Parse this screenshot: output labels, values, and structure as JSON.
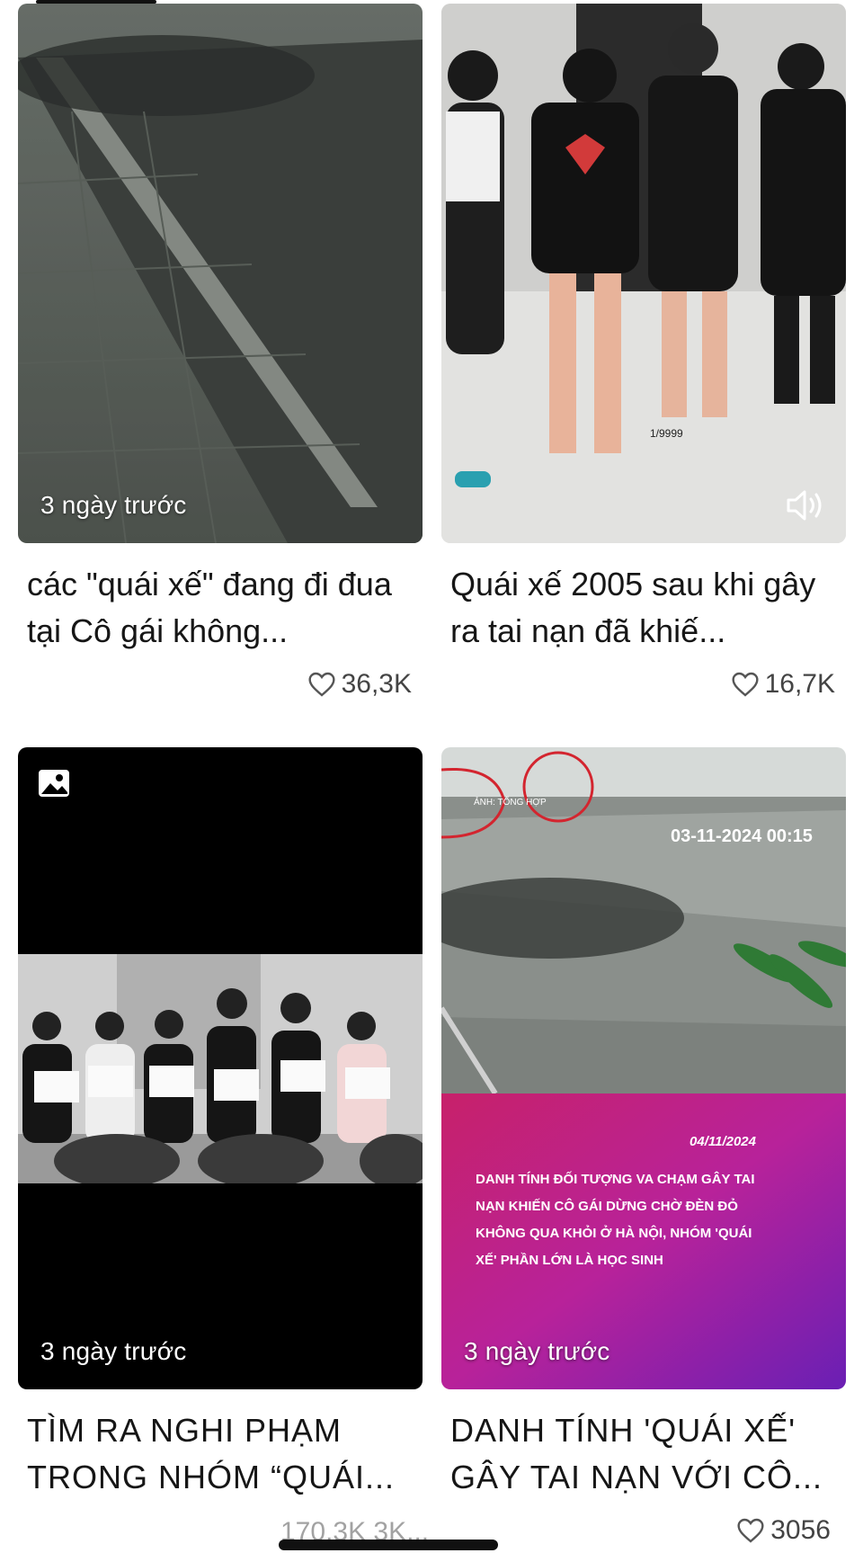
{
  "cards": [
    {
      "time": "3 ngày trước",
      "title": "các \"quái xế\" đang đi đua tại Cô gái không...",
      "likes": "36,3K"
    },
    {
      "title": "Quái xế 2005 sau khi gây ra tai nạn đã khiế...",
      "likes": "16,7K",
      "watermark": "1/9999"
    },
    {
      "time": "3 ngày trước",
      "title": "TÌM RA NGHI PHẠM TRONG NHÓM “QUÁI...",
      "likes_partial": "170,3K 3K..."
    },
    {
      "time": "3 ngày trước",
      "title": "DANH TÍNH 'QUÁI XẾ' GÂY TAI NẠN VỚI CÔ...",
      "likes": "3056",
      "overlay_source": "ẢNH: TỔNG HỢP",
      "overlay_timestamp": "03-11-2024 00:15",
      "overlay_date": "04/11/2024",
      "overlay_text": "DANH TÍNH ĐỐI TƯỢNG VA CHẠM GÂY TAI NẠN KHIẾN CÔ GÁI DỪNG CHỜ ĐÈN ĐỎ KHÔNG QUA KHỎI Ở HÀ NỘI, NHÓM 'QUÁI XẾ' PHẦN LỚN LÀ HỌC SINH"
    }
  ],
  "icons": {
    "heart": "heart-icon",
    "sound": "speaker-icon",
    "image": "image-icon"
  }
}
